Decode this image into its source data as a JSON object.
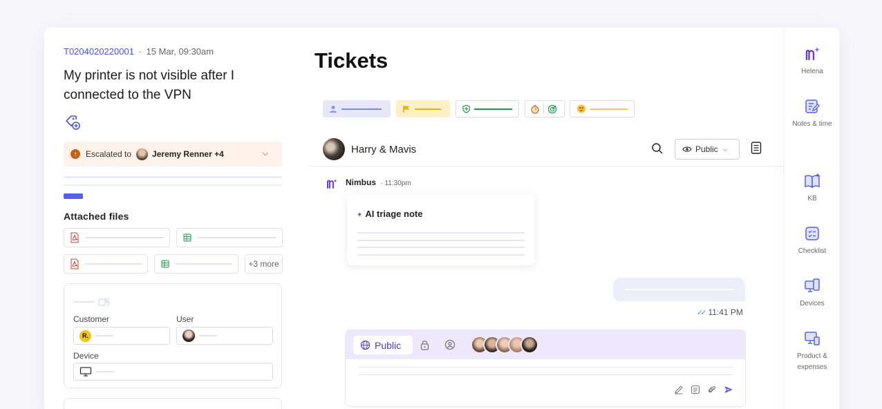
{
  "ticket": {
    "id": "T0204020220001",
    "separator": "·",
    "created": "15 Mar, 09:30am",
    "subject": "My printer is not visible after I connected to the VPN"
  },
  "escalation": {
    "prefix": "Escalated to",
    "assignee": "Jeremy Renner +4"
  },
  "attachments": {
    "title": "Attached files",
    "more_label": "+3 more",
    "files": [
      {
        "type": "pdf-icon"
      },
      {
        "type": "sheet-icon"
      },
      {
        "type": "pdf-icon"
      },
      {
        "type": "sheet-icon"
      }
    ]
  },
  "details": {
    "customer_label": "Customer",
    "customer_initial": "R.",
    "user_label": "User",
    "device_label": "Device"
  },
  "main": {
    "title": "Tickets",
    "chips": [
      {
        "name": "assignee-chip",
        "color": "#e6e8f8",
        "line": "#7f89e6"
      },
      {
        "name": "priority-chip",
        "color": "#fdf0c4",
        "line": "#e4b315"
      },
      {
        "name": "sla-chip",
        "color": "#ffffff",
        "line": "#1f9a4a"
      },
      {
        "name": "goal-chip",
        "color": "#ffffff",
        "line": ""
      },
      {
        "name": "sentiment-chip",
        "color": "#ffffff",
        "line": "#f0cf3a"
      }
    ]
  },
  "chat": {
    "contact": "Harry & Mavis",
    "visibility": "Public",
    "bot_name": "Nimbus",
    "bot_time": "11:30pm",
    "triage_title": "AI triage note",
    "outgoing_time": "11:41 PM"
  },
  "composer": {
    "mode_label": "Public"
  },
  "rail": {
    "items": [
      {
        "label": "Helena"
      },
      {
        "label": "Notes & time"
      },
      {
        "label": "KB"
      },
      {
        "label": "Checklist"
      },
      {
        "label": "Devices"
      },
      {
        "label": "Product & expenses"
      }
    ]
  },
  "colors": {
    "accent": "#5662e0",
    "brand_purple": "#7a3fe0",
    "escalation_bg": "#fdf3ea"
  }
}
